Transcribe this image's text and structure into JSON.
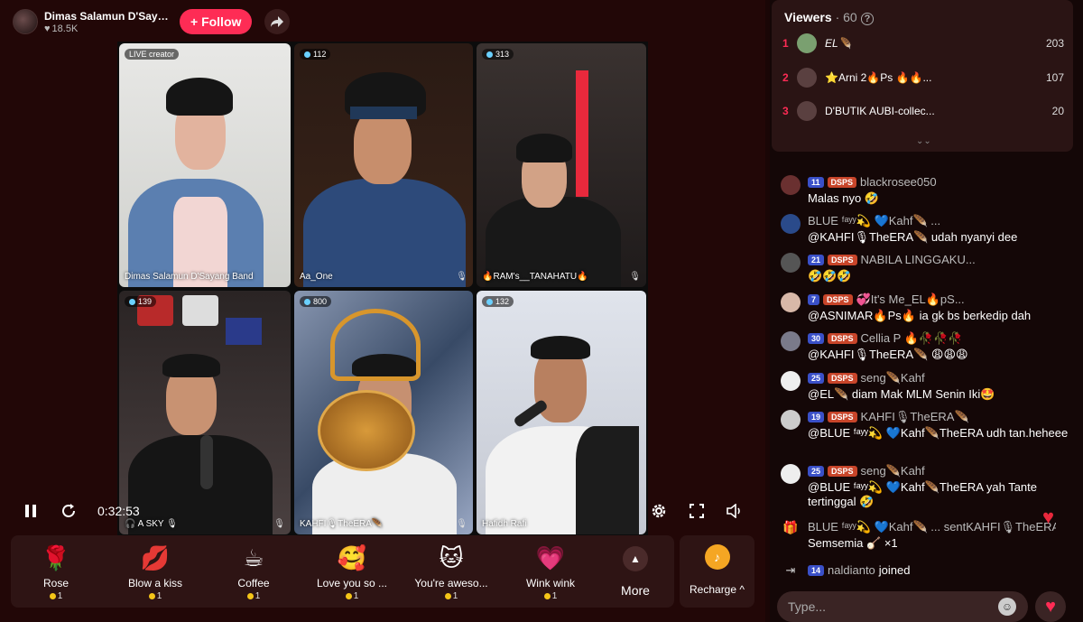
{
  "host": {
    "name": "Dimas Salamun D'Sayan...",
    "likes": "18.5K",
    "follow_label": "+ Follow"
  },
  "tiles": [
    {
      "badge": "LIVE creator",
      "name": "Dimas Salamun D'Sayang Band"
    },
    {
      "badge": "112",
      "name": "Aa_One"
    },
    {
      "badge": "313",
      "name": "🔥RAM's__TANAHATU🔥"
    },
    {
      "badge": "139",
      "name": "🎧 A SKY 🎙"
    },
    {
      "badge": "800",
      "name": "KAHFI🎙TheERA🪶"
    },
    {
      "badge": "132",
      "name": "Hafidh Rafi"
    }
  ],
  "player": {
    "time": "0:32:53"
  },
  "gifts": [
    {
      "icon": "🌹",
      "label": "Rose",
      "cost": "1"
    },
    {
      "icon": "💋",
      "label": "Blow a kiss",
      "cost": "1"
    },
    {
      "icon": "☕",
      "label": "Coffee",
      "cost": "1"
    },
    {
      "icon": "🥰",
      "label": "Love you so ...",
      "cost": "1"
    },
    {
      "icon": "🐱",
      "label": "You're aweso...",
      "cost": "1"
    },
    {
      "icon": "💗",
      "label": "Wink wink",
      "cost": "1"
    }
  ],
  "gift_more_label": "More",
  "recharge_label": "Recharge ^",
  "viewers": {
    "title": "Viewers",
    "count": "· 60",
    "top": [
      {
        "rank": "1",
        "name": "EL🪶",
        "score": "203"
      },
      {
        "rank": "2",
        "name": "⭐Arni 2🔥Ps 🔥🔥...",
        "score": "107"
      },
      {
        "rank": "3",
        "name": "D'BUTIK AUBI-collec...",
        "score": "20"
      }
    ]
  },
  "chat": [
    {
      "level": "11",
      "fan": "DSPS",
      "user": "blackrosee050",
      "text": "Malas nyo 🤣"
    },
    {
      "level": "",
      "fan": "",
      "user": "BLUE ᶠᵃʸʸ💫 💙Kahf🪶 ...",
      "text": "@KAHFI🎙TheERA🪶 udah nyanyi dee"
    },
    {
      "level": "21",
      "fan": "DSPS",
      "user": "NABILA LINGGAKU...",
      "text": "🤣🤣🤣"
    },
    {
      "level": "7",
      "fan": "DSPS",
      "user": "💞It's Me_EL🔥pS...",
      "text": "@ASNIMAR🔥Ps🔥 ia gk bs berkedip dah"
    },
    {
      "level": "30",
      "fan": "DSPS",
      "user": "Cellia P 🔥🥀🥀🥀",
      "text": "@KAHFI🎙TheERA🪶 😩😩😩"
    },
    {
      "level": "25",
      "fan": "DSPS",
      "user": "seng🪶Kahf",
      "text": "@EL🪶 diam Mak MLM Senin Iki🤩"
    },
    {
      "level": "19",
      "fan": "DSPS",
      "user": "KAHFI🎙TheERA🪶",
      "text": "@BLUE ᶠᵃʸʸ💫 💙Kahf🪶TheERA udh tan.heheee"
    },
    {
      "level": "25",
      "fan": "DSPS",
      "user": "seng🪶Kahf",
      "text": "@BLUE ᶠᵃʸʸ💫 💙Kahf🪶TheERA yah Tante tertinggal 🤣"
    },
    {
      "level": "",
      "fan": "",
      "user": "BLUE ᶠᵃʸʸ💫 💙Kahf🪶 ... sentKAHFI🎙TheERA🪶",
      "text": "Semsemia 🪕 ×1"
    },
    {
      "level": "14",
      "fan": "",
      "user": "naldianto",
      "text": "joined"
    }
  ],
  "input": {
    "placeholder": "Type..."
  }
}
